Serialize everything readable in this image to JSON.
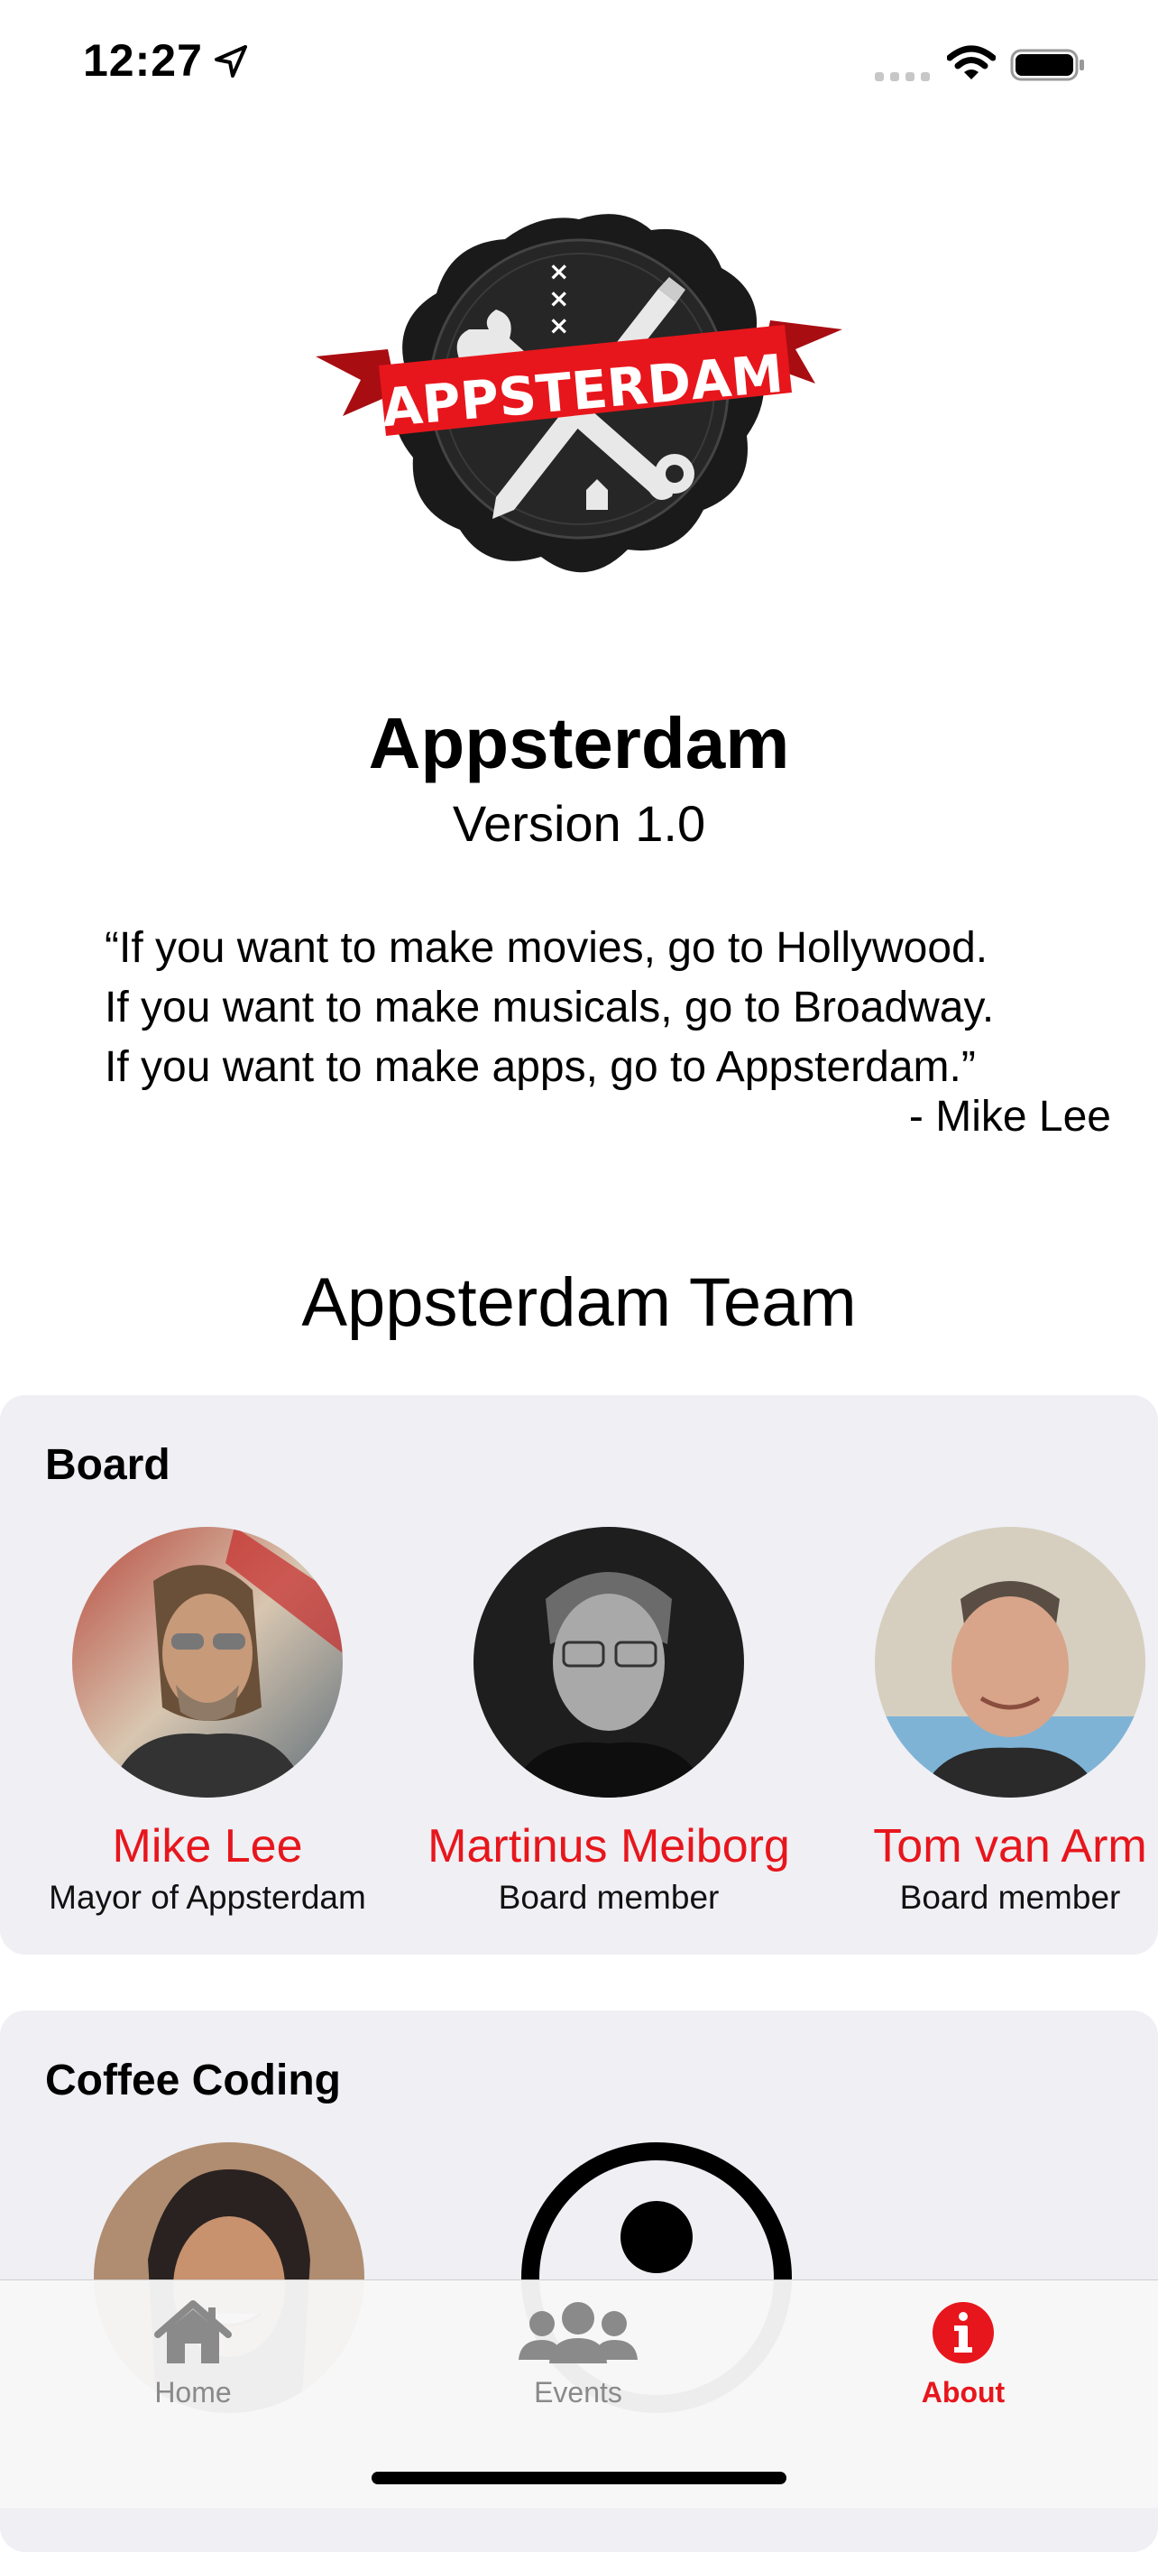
{
  "status_bar": {
    "time": "12:27",
    "icons": [
      "location-arrow-icon",
      "cellular-signal-icon",
      "wifi-icon",
      "battery-icon"
    ]
  },
  "logo": {
    "icon": "appsterdam-wax-seal-logo",
    "ribbon_text": "APPSTERDAM"
  },
  "app": {
    "name": "Appsterdam",
    "version": "Version 1.0"
  },
  "quote": {
    "lines": [
      "“If you want to make movies, go to Hollywood.",
      "If you want to make musicals, go to Broadway.",
      "If you want to make apps, go to Appsterdam.”"
    ],
    "author": "- Mike Lee"
  },
  "team": {
    "heading": "Appsterdam Team",
    "sections": [
      {
        "title": "Board",
        "members": [
          {
            "name": "Mike Lee",
            "role": "Mayor of Appsterdam"
          },
          {
            "name": "Martinus Meiborg",
            "role": "Board member"
          },
          {
            "name": "Tom van Arm",
            "role": "Board member"
          }
        ]
      },
      {
        "title": "Coffee Coding"
      }
    ]
  },
  "tabs": [
    {
      "label": "Home",
      "icon": "house-icon"
    },
    {
      "label": "Events",
      "icon": "people-group-icon"
    },
    {
      "label": "About",
      "icon": "info-circle-icon",
      "active": true
    }
  ],
  "colors": {
    "accent": "#e7161c",
    "card_bg": "#efeff4",
    "inactive_tab": "#8a8a8a"
  }
}
